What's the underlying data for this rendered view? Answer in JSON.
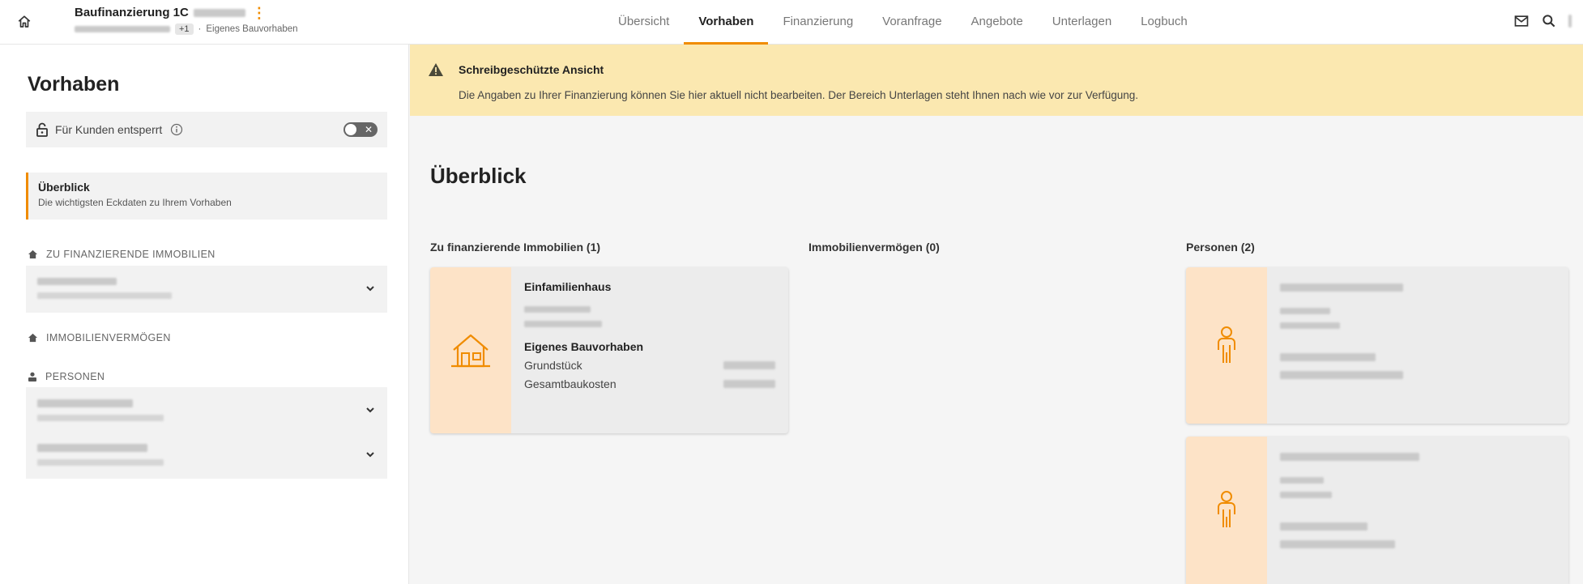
{
  "header": {
    "title": "Baufinanzierung 1C",
    "plus_count": "+1",
    "separator": "·",
    "project_type": "Eigenes Bauvorhaben",
    "kebab": "⋮",
    "home_icon": "home-icon",
    "tabs": [
      {
        "label": "Übersicht",
        "active": false
      },
      {
        "label": "Vorhaben",
        "active": true
      },
      {
        "label": "Finanzierung",
        "active": false
      },
      {
        "label": "Voranfrage",
        "active": false
      },
      {
        "label": "Angebote",
        "active": false
      },
      {
        "label": "Unterlagen",
        "active": false
      },
      {
        "label": "Logbuch",
        "active": false
      }
    ],
    "right_icons": [
      "mail-icon",
      "search-icon"
    ]
  },
  "sidebar": {
    "title": "Vorhaben",
    "lock": {
      "label": "Für Kunden entsperrt",
      "info_icon": "info-icon",
      "toggle_state": "off"
    },
    "overview": {
      "title": "Überblick",
      "subtitle": "Die wichtigsten Eckdaten zu Ihrem Vorhaben"
    },
    "sections": {
      "immobilien": "ZU FINANZIERENDE IMMOBILIEN",
      "vermoegen": "IMMOBILIENVERMÖGEN",
      "personen": "PERSONEN"
    }
  },
  "banner": {
    "title": "Schreibgeschützte Ansicht",
    "text": "Die Angaben zu Ihrer Finanzierung können Sie hier aktuell nicht bearbeiten. Der Bereich Unterlagen steht Ihnen nach wie vor zur Verfügung."
  },
  "main": {
    "title": "Überblick",
    "columns": {
      "immobilien": "Zu finanzierende Immobilien (1)",
      "vermoegen": "Immobilienvermögen (0)",
      "personen": "Personen (2)"
    },
    "property_card": {
      "type": "Einfamilienhaus",
      "project": "Eigenes Bauvorhaben",
      "rows": [
        {
          "label": "Grundstück"
        },
        {
          "label": "Gesamtbaukosten"
        }
      ]
    }
  },
  "colors": {
    "accent": "#f08c00",
    "banner_bg": "#fbe8b0",
    "card_side": "#fde3c7"
  }
}
